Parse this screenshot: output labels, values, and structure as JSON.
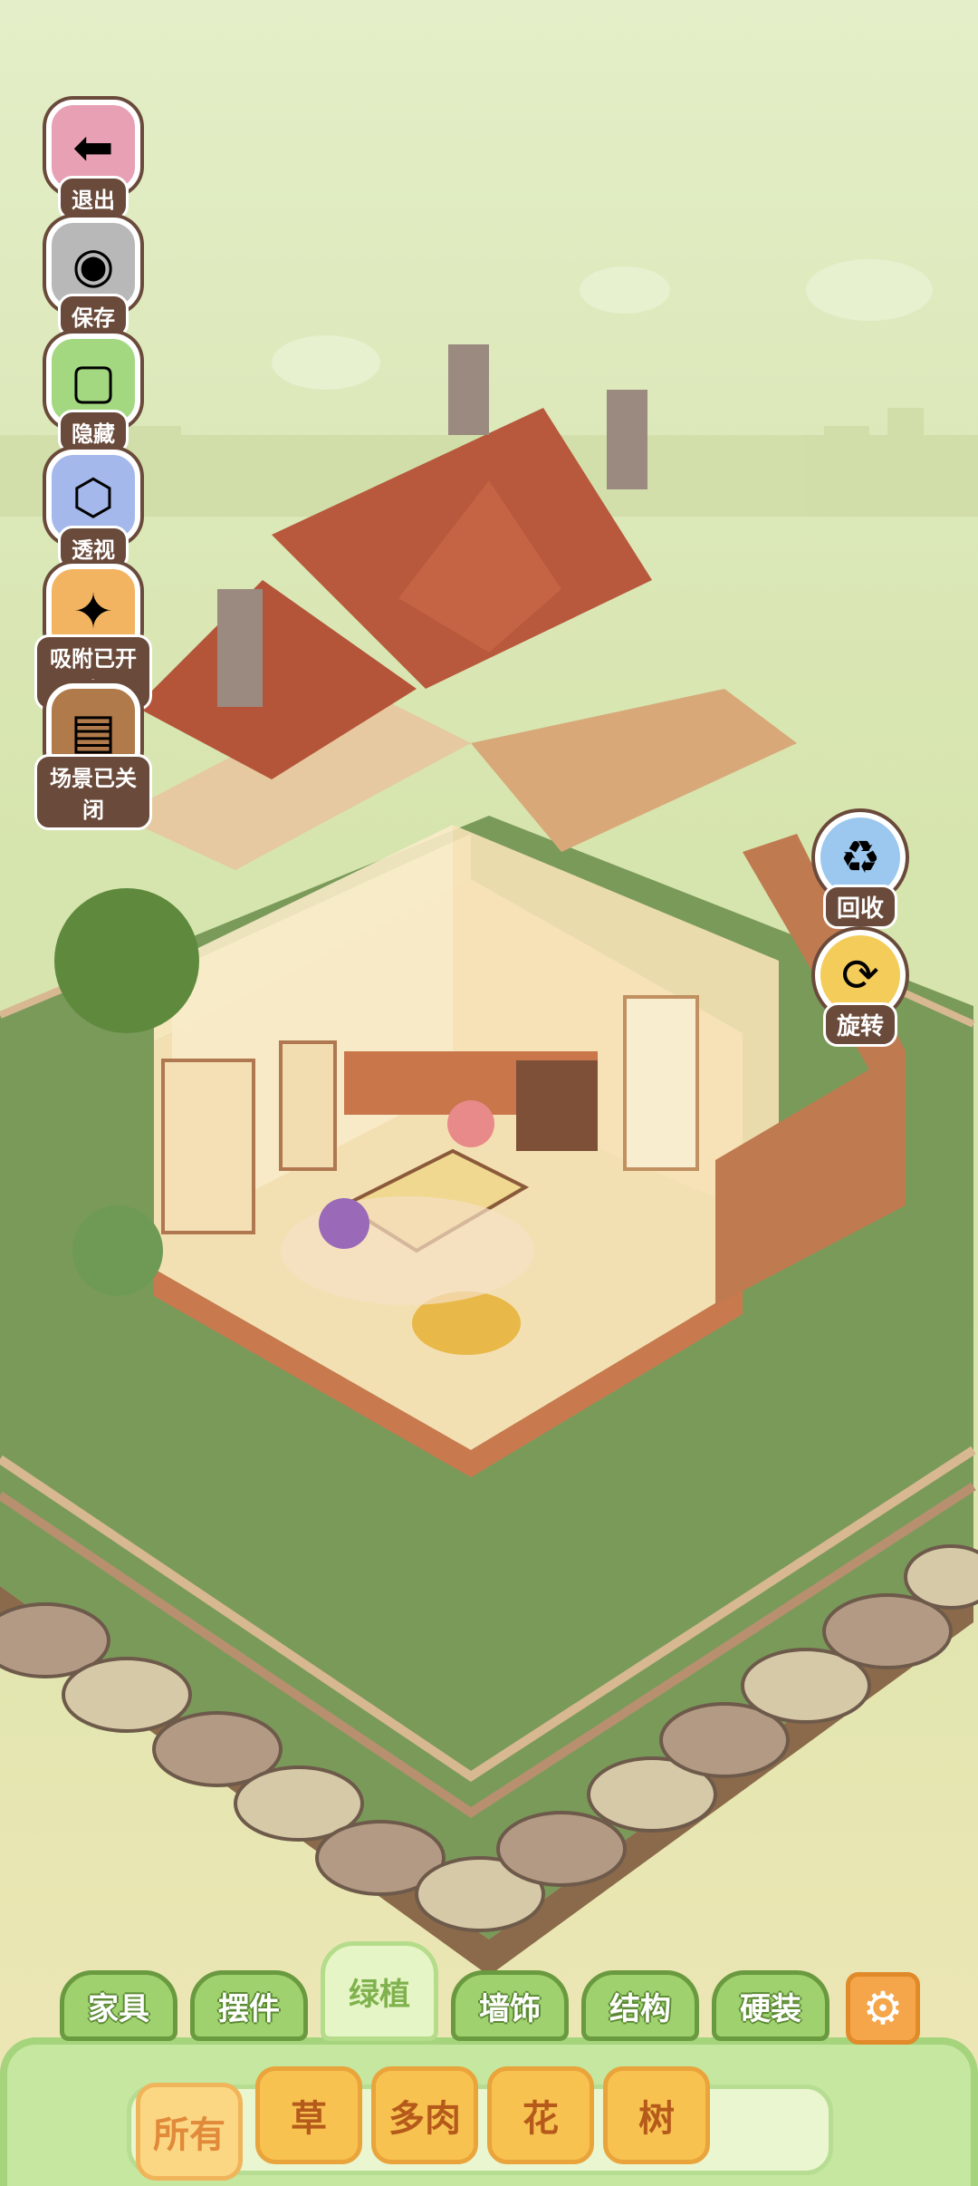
{
  "left_toolbar": [
    {
      "label": "退出",
      "icon": "exit-arrow-icon"
    },
    {
      "label": "保存",
      "icon": "save-hamster-icon"
    },
    {
      "label": "隐藏",
      "icon": "hide-frame-icon"
    },
    {
      "label": "透视",
      "icon": "perspective-cube-icon"
    },
    {
      "label": "吸附已开启",
      "icon": "snap-cat-icon"
    },
    {
      "label": "场景已关闭",
      "icon": "scene-wall-icon"
    }
  ],
  "right_toolbar": [
    {
      "label": "回收",
      "icon": "recycle-watering-can-icon"
    },
    {
      "label": "旋转",
      "icon": "rotate-icon"
    }
  ],
  "category_tabs": [
    {
      "label": "家具"
    },
    {
      "label": "摆件"
    },
    {
      "label": "绿植"
    },
    {
      "label": "墙饰"
    },
    {
      "label": "结构"
    },
    {
      "label": "硬装"
    }
  ],
  "active_category_index": 2,
  "settings_icon": "gear-icon",
  "sub_tabs": [
    {
      "label": "所有"
    },
    {
      "label": "草"
    },
    {
      "label": "多肉"
    },
    {
      "label": "花"
    },
    {
      "label": "树"
    }
  ],
  "active_sub_tab_index": 0,
  "colors": {
    "tab_green": "#9fd26e",
    "subtab_orange": "#f8c251",
    "settings_orange": "#f6a64a",
    "roof_red": "#b4553a",
    "grass_green": "#7a9a5a"
  }
}
